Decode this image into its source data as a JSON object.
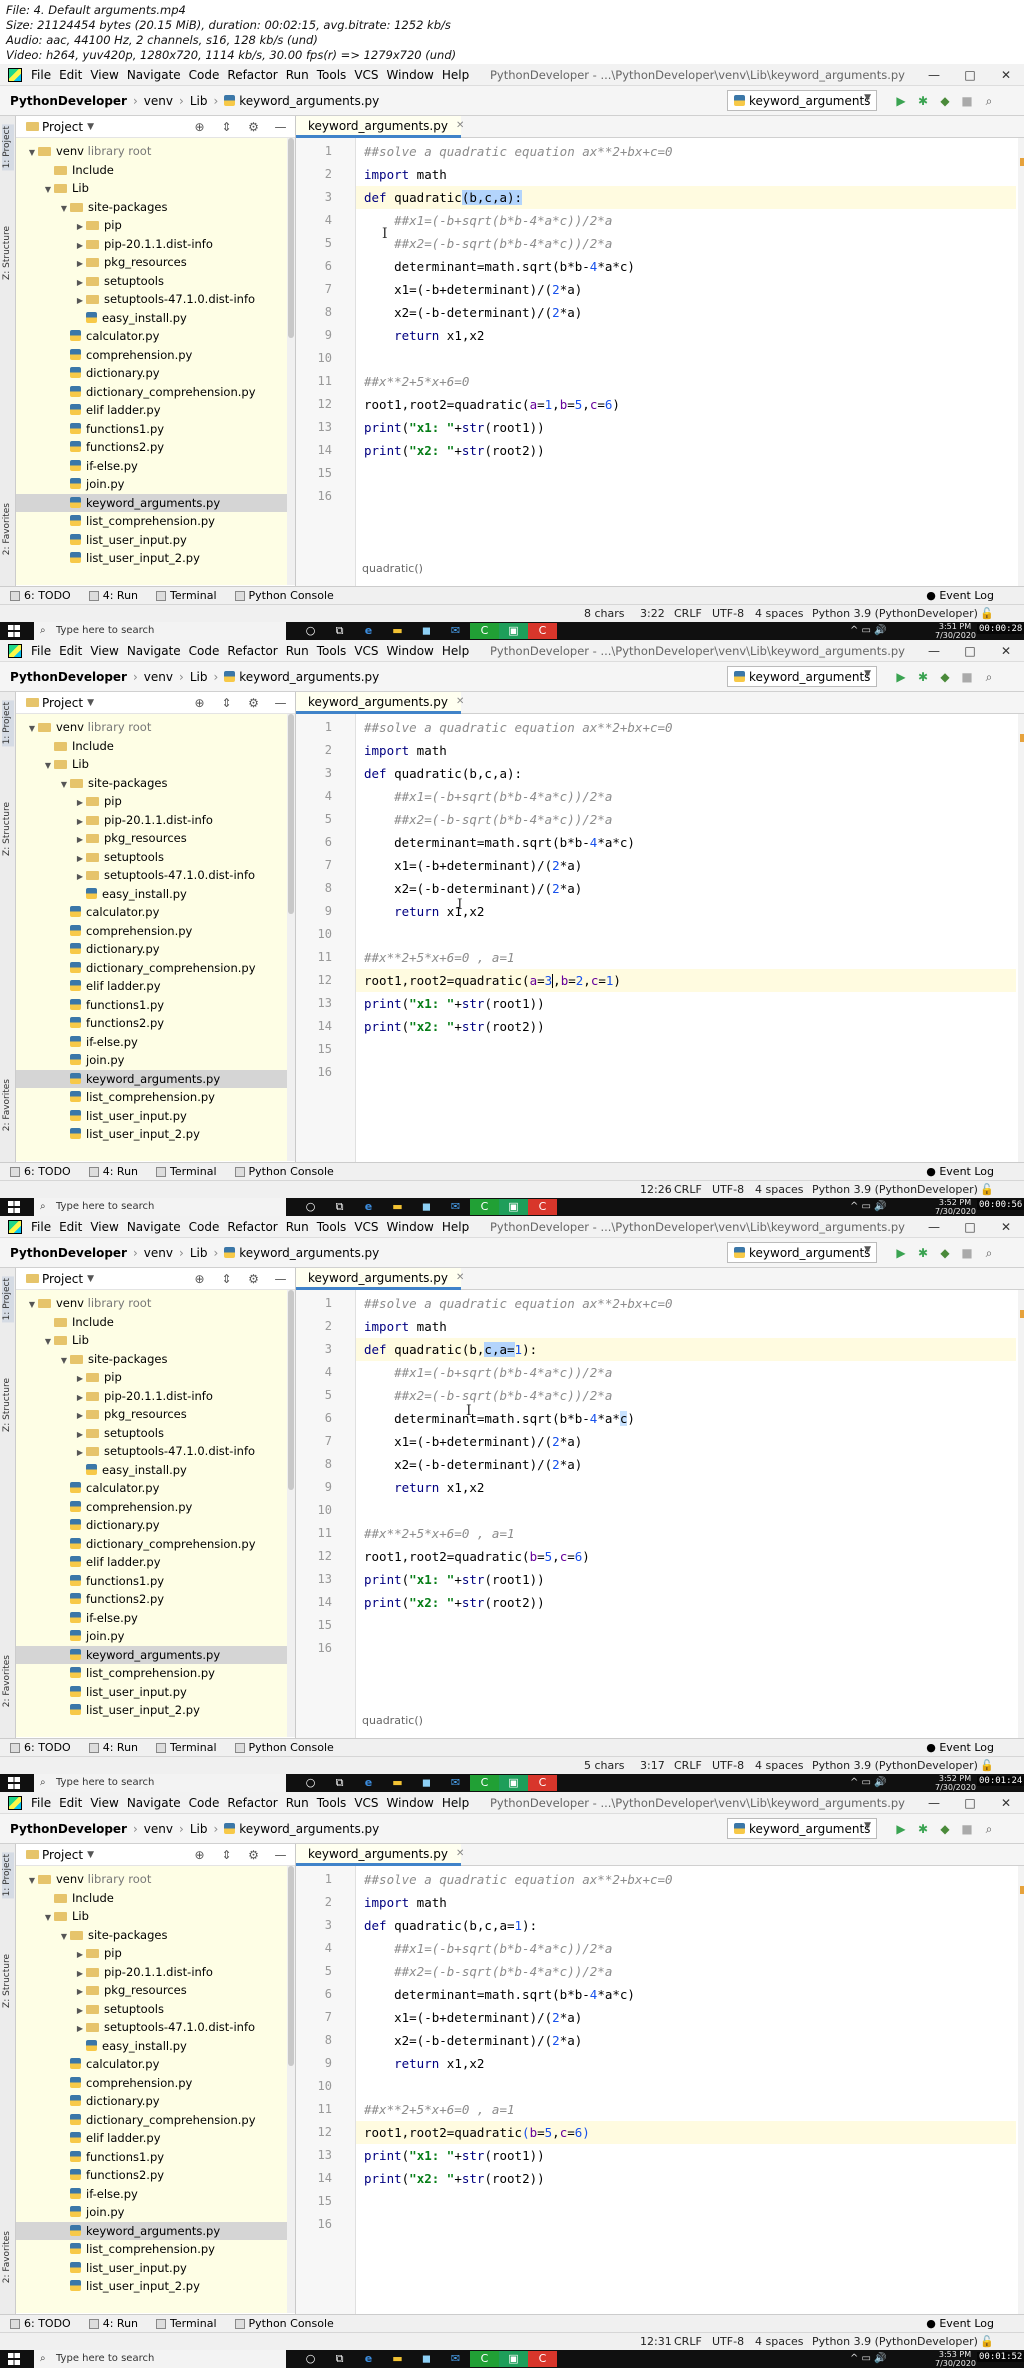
{
  "header": {
    "lines": [
      "File: 4. Default arguments.mp4",
      "Size: 21124454 bytes (20.15 MiB), duration: 00:02:15, avg.bitrate: 1252 kb/s",
      "Audio: aac, 44100 Hz, 2 channels, s16, 128 kb/s (und)",
      "Video: h264, yuv420p, 1280x720, 1114 kb/s, 30.00 fps(r) => 1279x720 (und)"
    ]
  },
  "ide": {
    "menu": [
      "File",
      "Edit",
      "View",
      "Navigate",
      "Code",
      "Refactor",
      "Run",
      "Tools",
      "VCS",
      "Window",
      "Help"
    ],
    "title_path": "PythonDeveloper - ...\\PythonDeveloper\\venv\\Lib\\keyword_arguments.py",
    "nav": {
      "root": "PythonDeveloper",
      "venv": "venv",
      "lib": "Lib",
      "file": "keyword_arguments.py"
    },
    "run_config": "keyword_arguments",
    "project_label": "Project",
    "tab_label": "keyword_arguments.py",
    "side_labels": {
      "project": "1: Project",
      "structure": "Z: Structure",
      "favorites": "2: Favorites"
    },
    "tree": [
      {
        "name": "venv",
        "suffix": " library root",
        "type": "folder",
        "depth": 0,
        "arrow": "▼"
      },
      {
        "name": "Include",
        "type": "folder",
        "depth": 1,
        "arrow": ""
      },
      {
        "name": "Lib",
        "type": "folder",
        "depth": 1,
        "arrow": "▼"
      },
      {
        "name": "site-packages",
        "type": "folder",
        "depth": 2,
        "arrow": "▼"
      },
      {
        "name": "pip",
        "type": "folder",
        "depth": 3,
        "arrow": "▶"
      },
      {
        "name": "pip-20.1.1.dist-info",
        "type": "folder",
        "depth": 3,
        "arrow": "▶"
      },
      {
        "name": "pkg_resources",
        "type": "folder",
        "depth": 3,
        "arrow": "▶"
      },
      {
        "name": "setuptools",
        "type": "folder",
        "depth": 3,
        "arrow": "▶"
      },
      {
        "name": "setuptools-47.1.0.dist-info",
        "type": "folder",
        "depth": 3,
        "arrow": "▶"
      },
      {
        "name": "easy_install.py",
        "type": "file",
        "depth": 3,
        "arrow": ""
      },
      {
        "name": "calculator.py",
        "type": "file",
        "depth": 2,
        "arrow": ""
      },
      {
        "name": "comprehension.py",
        "type": "file",
        "depth": 2,
        "arrow": ""
      },
      {
        "name": "dictionary.py",
        "type": "file",
        "depth": 2,
        "arrow": ""
      },
      {
        "name": "dictionary_comprehension.py",
        "type": "file",
        "depth": 2,
        "arrow": ""
      },
      {
        "name": "elif ladder.py",
        "type": "file",
        "depth": 2,
        "arrow": ""
      },
      {
        "name": "functions1.py",
        "type": "file",
        "depth": 2,
        "arrow": ""
      },
      {
        "name": "functions2.py",
        "type": "file",
        "depth": 2,
        "arrow": ""
      },
      {
        "name": "if-else.py",
        "type": "file",
        "depth": 2,
        "arrow": ""
      },
      {
        "name": "join.py",
        "type": "file",
        "depth": 2,
        "arrow": ""
      },
      {
        "name": "keyword_arguments.py",
        "type": "file",
        "depth": 2,
        "arrow": "",
        "selected": true
      },
      {
        "name": "list_comprehension.py",
        "type": "file",
        "depth": 2,
        "arrow": ""
      },
      {
        "name": "list_user_input.py",
        "type": "file",
        "depth": 2,
        "arrow": ""
      },
      {
        "name": "list_user_input_2.py",
        "type": "file",
        "depth": 2,
        "arrow": ""
      }
    ],
    "bottom_tabs": [
      "6: TODO",
      "4: Run",
      "Terminal",
      "Python Console"
    ],
    "event_log": "Event Log",
    "status_common": {
      "crlf": "CRLF",
      "enc": "UTF-8",
      "indent": "4 spaces",
      "interp": "Python 3.9 (PythonDeveloper)"
    }
  },
  "taskbar": {
    "search": "Type here to search"
  },
  "frames": [
    {
      "time_l1": "3:51 PM",
      "time_l2": "7/30/2020",
      "stamp": "00:00:28",
      "status": {
        "chars": "8 chars",
        "pos": "3:22"
      },
      "breadcrumb": "quadratic()",
      "current_line": 3,
      "lines": [
        [
          {
            "t": "##solve a quadratic equation ax**2+bx+c=0",
            "c": "cm"
          }
        ],
        [
          {
            "t": "import",
            "c": "kw"
          },
          {
            "t": " math"
          }
        ],
        [
          {
            "t": "def",
            "c": "kw"
          },
          {
            "t": " quadratic"
          },
          {
            "t": "(b,c,a):",
            "c": "hl"
          }
        ],
        [
          {
            "t": "    ##x1=(-b+sqrt(b*b-4*a*c))/2*a",
            "c": "cm"
          }
        ],
        [
          {
            "t": "    ##x2=(-b-sqrt(b*b-4*a*c))/2*a",
            "c": "cm"
          }
        ],
        [
          {
            "t": "    determinant=math.sqrt(b*b-"
          },
          {
            "t": "4",
            "c": "num"
          },
          {
            "t": "*a*c)"
          }
        ],
        [
          {
            "t": "    x1=(-b+determinant)/("
          },
          {
            "t": "2",
            "c": "num"
          },
          {
            "t": "*a)"
          }
        ],
        [
          {
            "t": "    x2=(-b-determinant)/("
          },
          {
            "t": "2",
            "c": "num"
          },
          {
            "t": "*a)"
          }
        ],
        [
          {
            "t": "    "
          },
          {
            "t": "return",
            "c": "kw"
          },
          {
            "t": " x1,x2"
          }
        ],
        [
          {
            "t": ""
          }
        ],
        [
          {
            "t": "##x**2+5*x+6=0",
            "c": "cm"
          }
        ],
        [
          {
            "t": "root1,root2=quadratic("
          },
          {
            "t": "a",
            "c": "kwarg"
          },
          {
            "t": "="
          },
          {
            "t": "1",
            "c": "num"
          },
          {
            "t": ","
          },
          {
            "t": "b",
            "c": "kwarg"
          },
          {
            "t": "="
          },
          {
            "t": "5",
            "c": "num"
          },
          {
            "t": ","
          },
          {
            "t": "c",
            "c": "kwarg"
          },
          {
            "t": "="
          },
          {
            "t": "6",
            "c": "num"
          },
          {
            "t": ")"
          }
        ],
        [
          {
            "t": "print",
            "c": "kw"
          },
          {
            "t": "("
          },
          {
            "t": "\"x1: \"",
            "c": "str"
          },
          {
            "t": "+"
          },
          {
            "t": "str",
            "c": "kw"
          },
          {
            "t": "(root1))"
          }
        ],
        [
          {
            "t": "print",
            "c": "kw"
          },
          {
            "t": "("
          },
          {
            "t": "\"x2: \"",
            "c": "str"
          },
          {
            "t": "+"
          },
          {
            "t": "str",
            "c": "kw"
          },
          {
            "t": "(root2))"
          }
        ],
        [
          {
            "t": ""
          }
        ],
        [
          {
            "t": ""
          }
        ]
      ]
    },
    {
      "time_l1": "3:52 PM",
      "time_l2": "7/30/2020",
      "stamp": "00:00:56",
      "status": {
        "chars": "",
        "pos": "12:26"
      },
      "breadcrumb": "",
      "current_line": 12,
      "lines": [
        [
          {
            "t": "##solve a quadratic equation ax**2+bx+c=0",
            "c": "cm"
          }
        ],
        [
          {
            "t": "import",
            "c": "kw"
          },
          {
            "t": " math"
          }
        ],
        [
          {
            "t": "def",
            "c": "kw"
          },
          {
            "t": " quadratic(b,c,a):"
          }
        ],
        [
          {
            "t": "    ##x1=(-b+sqrt(b*b-4*a*c))/2*a",
            "c": "cm"
          }
        ],
        [
          {
            "t": "    ##x2=(-b-sqrt(b*b-4*a*c))/2*a",
            "c": "cm"
          }
        ],
        [
          {
            "t": "    determinant=math.sqrt(b*b-"
          },
          {
            "t": "4",
            "c": "num"
          },
          {
            "t": "*a*c)"
          }
        ],
        [
          {
            "t": "    x1=(-b+determinant)/("
          },
          {
            "t": "2",
            "c": "num"
          },
          {
            "t": "*a)"
          }
        ],
        [
          {
            "t": "    x2=(-b-determinant)/("
          },
          {
            "t": "2",
            "c": "num"
          },
          {
            "t": "*a)"
          }
        ],
        [
          {
            "t": "    "
          },
          {
            "t": "return",
            "c": "kw"
          },
          {
            "t": " x1,x2"
          }
        ],
        [
          {
            "t": ""
          }
        ],
        [
          {
            "t": "##x**2+5*x+6=0 , a=1",
            "c": "cm"
          }
        ],
        [
          {
            "t": "root1,root2=quadratic("
          },
          {
            "t": "a",
            "c": "kwarg"
          },
          {
            "t": "="
          },
          {
            "t": "3",
            "c": "num"
          },
          {
            "t": "|",
            "c": "caret"
          },
          {
            "t": ","
          },
          {
            "t": "b",
            "c": "kwarg"
          },
          {
            "t": "="
          },
          {
            "t": "2",
            "c": "num"
          },
          {
            "t": ","
          },
          {
            "t": "c",
            "c": "kwarg"
          },
          {
            "t": "="
          },
          {
            "t": "1",
            "c": "num"
          },
          {
            "t": ")"
          }
        ],
        [
          {
            "t": "print",
            "c": "kw"
          },
          {
            "t": "("
          },
          {
            "t": "\"x1: \"",
            "c": "str"
          },
          {
            "t": "+"
          },
          {
            "t": "str",
            "c": "kw"
          },
          {
            "t": "(root1))"
          }
        ],
        [
          {
            "t": "print",
            "c": "kw"
          },
          {
            "t": "("
          },
          {
            "t": "\"x2: \"",
            "c": "str"
          },
          {
            "t": "+"
          },
          {
            "t": "str",
            "c": "kw"
          },
          {
            "t": "(root2))"
          }
        ],
        [
          {
            "t": ""
          }
        ],
        [
          {
            "t": ""
          }
        ]
      ]
    },
    {
      "time_l1": "3:52 PM",
      "time_l2": "7/30/2020",
      "stamp": "00:01:24",
      "status": {
        "chars": "5 chars",
        "pos": "3:17"
      },
      "breadcrumb": "quadratic()",
      "current_line": 3,
      "lines": [
        [
          {
            "t": "##solve a quadratic equation ax**2+bx+c=0",
            "c": "cm"
          }
        ],
        [
          {
            "t": "import",
            "c": "kw"
          },
          {
            "t": " math"
          }
        ],
        [
          {
            "t": "def",
            "c": "kw"
          },
          {
            "t": " quadratic(b,"
          },
          {
            "t": "c,a=",
            "c": "hl"
          },
          {
            "t": "1",
            "c": "num"
          },
          {
            "t": "):"
          }
        ],
        [
          {
            "t": "    ##x1=(-b+sqrt(b*b-4*a*c))/2*a",
            "c": "cm"
          }
        ],
        [
          {
            "t": "    ##x2=(-b-sqrt(b*b-4*a*c))/2*a",
            "c": "cm"
          }
        ],
        [
          {
            "t": "    determinant=math.sqrt(b*b-"
          },
          {
            "t": "4",
            "c": "num"
          },
          {
            "t": "*a*"
          },
          {
            "t": "c",
            "c": "hl2"
          },
          {
            "t": ")"
          }
        ],
        [
          {
            "t": "    x1=(-b+determinant)/("
          },
          {
            "t": "2",
            "c": "num"
          },
          {
            "t": "*a)"
          }
        ],
        [
          {
            "t": "    x2=(-b-determinant)/("
          },
          {
            "t": "2",
            "c": "num"
          },
          {
            "t": "*a)"
          }
        ],
        [
          {
            "t": "    "
          },
          {
            "t": "return",
            "c": "kw"
          },
          {
            "t": " x1,x2"
          }
        ],
        [
          {
            "t": ""
          }
        ],
        [
          {
            "t": "##x**2+5*x+6=0 , a=1",
            "c": "cm"
          }
        ],
        [
          {
            "t": "root1,root2=quadratic("
          },
          {
            "t": "b",
            "c": "kwarg"
          },
          {
            "t": "="
          },
          {
            "t": "5",
            "c": "num"
          },
          {
            "t": ","
          },
          {
            "t": "c",
            "c": "kwarg"
          },
          {
            "t": "="
          },
          {
            "t": "6",
            "c": "num"
          },
          {
            "t": ")"
          }
        ],
        [
          {
            "t": "print",
            "c": "kw"
          },
          {
            "t": "("
          },
          {
            "t": "\"x1: \"",
            "c": "str"
          },
          {
            "t": "+"
          },
          {
            "t": "str",
            "c": "kw"
          },
          {
            "t": "(root1))"
          }
        ],
        [
          {
            "t": "print",
            "c": "kw"
          },
          {
            "t": "("
          },
          {
            "t": "\"x2: \"",
            "c": "str"
          },
          {
            "t": "+"
          },
          {
            "t": "str",
            "c": "kw"
          },
          {
            "t": "(root2))"
          }
        ],
        [
          {
            "t": ""
          }
        ],
        [
          {
            "t": ""
          }
        ]
      ]
    },
    {
      "time_l1": "3:53 PM",
      "time_l2": "7/30/2020",
      "stamp": "00:01:52",
      "status": {
        "chars": "",
        "pos": "12:31"
      },
      "breadcrumb": "",
      "current_line": 12,
      "lines": [
        [
          {
            "t": "##solve a quadratic equation ax**2+bx+c=0",
            "c": "cm"
          }
        ],
        [
          {
            "t": "import",
            "c": "kw"
          },
          {
            "t": " math"
          }
        ],
        [
          {
            "t": "def",
            "c": "kw"
          },
          {
            "t": " quadratic(b,c,a="
          },
          {
            "t": "1",
            "c": "num"
          },
          {
            "t": "):"
          }
        ],
        [
          {
            "t": "    ##x1=(-b+sqrt(b*b-4*a*c))/2*a",
            "c": "cm"
          }
        ],
        [
          {
            "t": "    ##x2=(-b-sqrt(b*b-4*a*c))/2*a",
            "c": "cm"
          }
        ],
        [
          {
            "t": "    determinant=math.sqrt(b*b-"
          },
          {
            "t": "4",
            "c": "num"
          },
          {
            "t": "*a*c)"
          }
        ],
        [
          {
            "t": "    x1=(-b+determinant)/("
          },
          {
            "t": "2",
            "c": "num"
          },
          {
            "t": "*a)"
          }
        ],
        [
          {
            "t": "    x2=(-b-determinant)/("
          },
          {
            "t": "2",
            "c": "num"
          },
          {
            "t": "*a)"
          }
        ],
        [
          {
            "t": "    "
          },
          {
            "t": "return",
            "c": "kw"
          },
          {
            "t": " x1,x2"
          }
        ],
        [
          {
            "t": ""
          }
        ],
        [
          {
            "t": "##x**2+5*x+6=0 , a=1",
            "c": "cm"
          }
        ],
        [
          {
            "t": "root1,root2=quadratic"
          },
          {
            "t": "(",
            "c": "br"
          },
          {
            "t": "b",
            "c": "kwarg"
          },
          {
            "t": "="
          },
          {
            "t": "5",
            "c": "num"
          },
          {
            "t": ","
          },
          {
            "t": "c",
            "c": "kwarg"
          },
          {
            "t": "="
          },
          {
            "t": "6",
            "c": "num"
          },
          {
            "t": ")",
            "c": "br"
          }
        ],
        [
          {
            "t": "print",
            "c": "kw"
          },
          {
            "t": "("
          },
          {
            "t": "\"x1: \"",
            "c": "str"
          },
          {
            "t": "+"
          },
          {
            "t": "str",
            "c": "kw"
          },
          {
            "t": "(root1))"
          }
        ],
        [
          {
            "t": "print",
            "c": "kw"
          },
          {
            "t": "("
          },
          {
            "t": "\"x2: \"",
            "c": "str"
          },
          {
            "t": "+"
          },
          {
            "t": "str",
            "c": "kw"
          },
          {
            "t": "(root2))"
          }
        ],
        [
          {
            "t": ""
          }
        ],
        [
          {
            "t": ""
          }
        ]
      ]
    }
  ]
}
